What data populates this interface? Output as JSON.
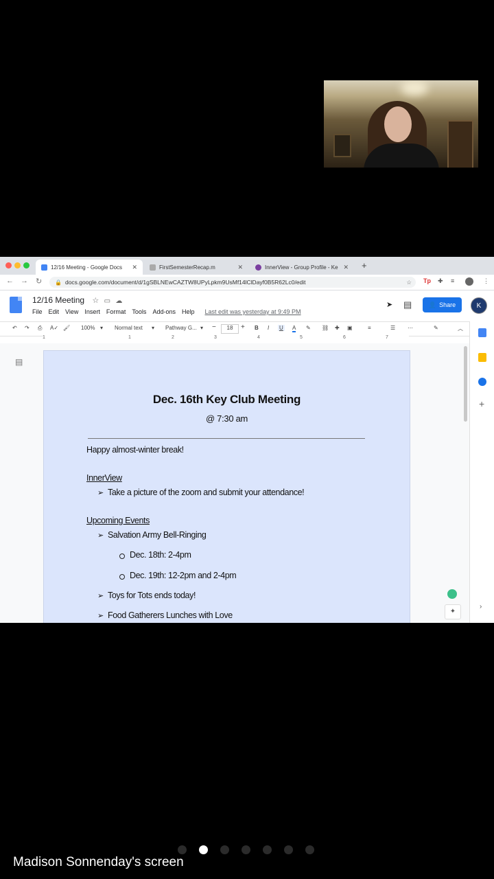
{
  "browser": {
    "tabs": [
      {
        "title": "12/16 Meeting - Google Docs",
        "active": true
      },
      {
        "title": "FirstSemesterRecap.m",
        "active": false
      },
      {
        "title": "InnerView - Group Profile - Ke",
        "active": false
      }
    ],
    "url": "docs.google.com/document/d/1gSBLNEwCAZTW8UPyLpkm9UsMf14lClDayf0B5R62Lc0/edit"
  },
  "docs": {
    "title": "12/16 Meeting",
    "menus": [
      "File",
      "Edit",
      "View",
      "Insert",
      "Format",
      "Tools",
      "Add-ons",
      "Help"
    ],
    "last_edit": "Last edit was yesterday at 9:49 PM",
    "share_label": "Share",
    "toolbar": {
      "zoom": "100%",
      "style": "Normal text",
      "font": "Pathway G...",
      "font_size": "18"
    },
    "ruler_marks": [
      "1",
      "1",
      "2",
      "3",
      "4",
      "5",
      "6",
      "7"
    ]
  },
  "document": {
    "heading": "Dec. 16th Key Club Meeting",
    "subheading": "@ 7:30 am",
    "greeting": "Happy almost-winter break!",
    "section1": "InnerView",
    "section1_items": [
      "Take a picture of the zoom and submit your attendance!"
    ],
    "section2": "Upcoming Events",
    "event1": "Salvation Army Bell-Ringing",
    "event1_sub": [
      "Dec. 18th: 2-4pm",
      "Dec. 19th: 12-2pm and 2-4pm"
    ],
    "event2": "Toys for Tots ends today!",
    "event3": "Food Gatherers Lunches with Love"
  },
  "pager": {
    "count": 7,
    "active_index": 1
  },
  "caption": "Madison Sonnenday's screen"
}
